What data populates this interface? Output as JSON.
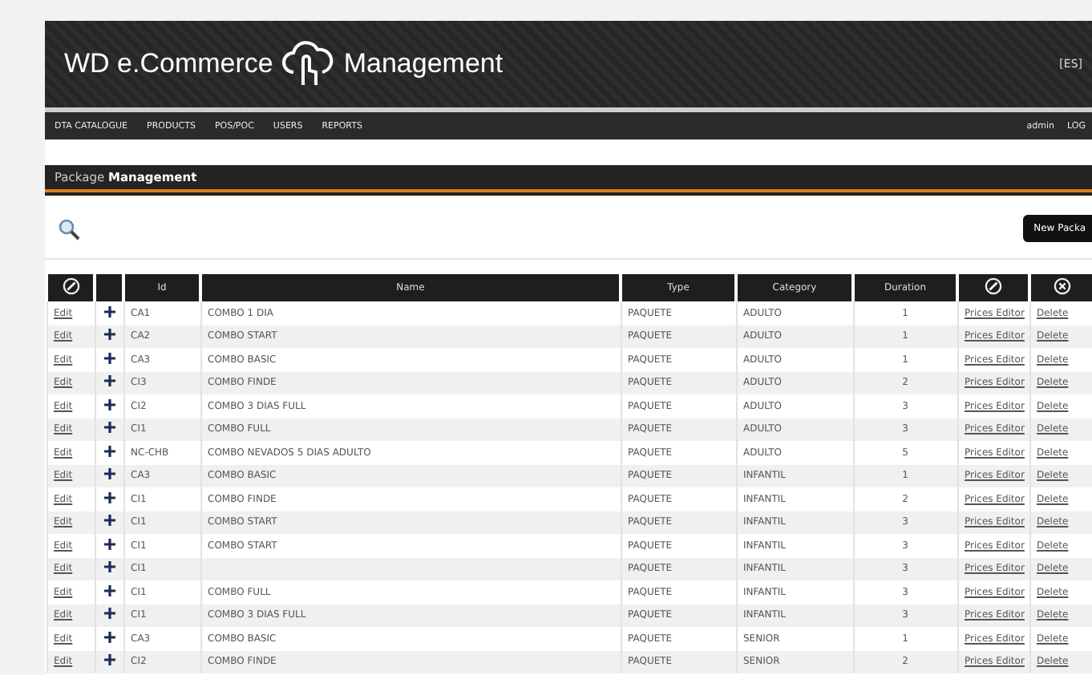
{
  "header": {
    "brand_left": "WD e.Commerce",
    "brand_right": "Management",
    "language": "[ES]"
  },
  "nav": {
    "items": [
      {
        "label": "DTA CATALOGUE",
        "selected": false
      },
      {
        "label": "PRODUCTS",
        "selected": false
      },
      {
        "label": "POS/POC",
        "selected": false
      },
      {
        "label": "USERS",
        "selected": false
      },
      {
        "label": "REPORTS",
        "selected": false
      }
    ],
    "user": "admin",
    "logout": "LOG"
  },
  "section": {
    "title_prefix": "Package",
    "title_main": "Management"
  },
  "toolbar": {
    "new_button": "New Packa"
  },
  "table": {
    "columns": [
      "Id",
      "Name",
      "Type",
      "Category",
      "Duration"
    ],
    "rows": [
      {
        "edit": "Edit",
        "id": "CA1",
        "name": "COMBO 1 DIA",
        "type": "PAQUETE",
        "category": "ADULTO",
        "duration": "1",
        "prices": "Prices Editor",
        "delete": "Delete"
      },
      {
        "edit": "Edit",
        "id": "CA2",
        "name": "COMBO START",
        "type": "PAQUETE",
        "category": "ADULTO",
        "duration": "1",
        "prices": "Prices Editor",
        "delete": "Delete"
      },
      {
        "edit": "Edit",
        "id": "CA3",
        "name": "COMBO BASIC",
        "type": "PAQUETE",
        "category": "ADULTO",
        "duration": "1",
        "prices": "Prices Editor",
        "delete": "Delete"
      },
      {
        "edit": "Edit",
        "id": "CI3",
        "name": "COMBO FINDE",
        "type": "PAQUETE",
        "category": "ADULTO",
        "duration": "2",
        "prices": "Prices Editor",
        "delete": "Delete"
      },
      {
        "edit": "Edit",
        "id": "CI2",
        "name": "COMBO 3 DIAS FULL",
        "type": "PAQUETE",
        "category": "ADULTO",
        "duration": "3",
        "prices": "Prices Editor",
        "delete": "Delete"
      },
      {
        "edit": "Edit",
        "id": "CI1",
        "name": "COMBO FULL",
        "type": "PAQUETE",
        "category": "ADULTO",
        "duration": "3",
        "prices": "Prices Editor",
        "delete": "Delete"
      },
      {
        "edit": "Edit",
        "id": "NC-CHB",
        "name": "COMBO NEVADOS 5 DIAS ADULTO",
        "type": "PAQUETE",
        "category": "ADULTO",
        "duration": "5",
        "prices": "Prices Editor",
        "delete": "Delete"
      },
      {
        "edit": "Edit",
        "id": "CA3",
        "name": "COMBO BASIC",
        "type": "PAQUETE",
        "category": "INFANTIL",
        "duration": "1",
        "prices": "Prices Editor",
        "delete": "Delete"
      },
      {
        "edit": "Edit",
        "id": "CI1",
        "name": "COMBO FINDE",
        "type": "PAQUETE",
        "category": "INFANTIL",
        "duration": "2",
        "prices": "Prices Editor",
        "delete": "Delete"
      },
      {
        "edit": "Edit",
        "id": "CI1",
        "name": "COMBO START",
        "type": "PAQUETE",
        "category": "INFANTIL",
        "duration": "3",
        "prices": "Prices Editor",
        "delete": "Delete"
      },
      {
        "edit": "Edit",
        "id": "CI1",
        "name": "COMBO START",
        "type": "PAQUETE",
        "category": "INFANTIL",
        "duration": "3",
        "prices": "Prices Editor",
        "delete": "Delete"
      },
      {
        "edit": "Edit",
        "id": "CI1",
        "type": "PAQUETE",
        "category": "INFANTIL",
        "duration": "3",
        "prices": "Prices Editor",
        "delete": "Delete"
      },
      {
        "edit": "Edit",
        "id": "CI1",
        "name": "COMBO FULL",
        "type": "PAQUETE",
        "category": "INFANTIL",
        "duration": "3",
        "prices": "Prices Editor",
        "delete": "Delete"
      },
      {
        "edit": "Edit",
        "id": "CI1",
        "name": "COMBO 3 DIAS FULL",
        "type": "PAQUETE",
        "category": "INFANTIL",
        "duration": "3",
        "prices": "Prices Editor",
        "delete": "Delete"
      },
      {
        "edit": "Edit",
        "id": "CA3",
        "name": "COMBO BASIC",
        "type": "PAQUETE",
        "category": "SENIOR",
        "duration": "1",
        "prices": "Prices Editor",
        "delete": "Delete"
      },
      {
        "edit": "Edit",
        "id": "CI2",
        "name": "COMBO FINDE",
        "type": "PAQUETE",
        "category": "SENIOR",
        "duration": "2",
        "prices": "Prices Editor",
        "delete": "Delete"
      }
    ]
  }
}
